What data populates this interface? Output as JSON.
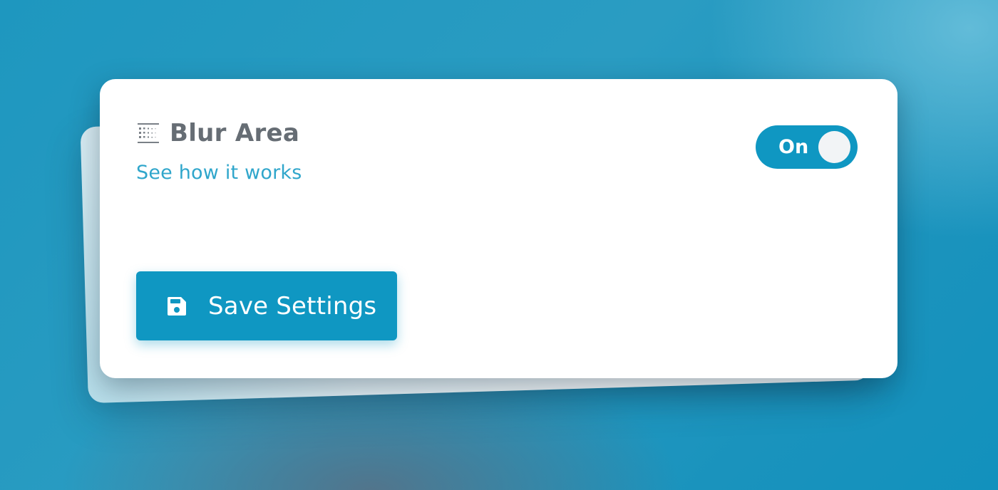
{
  "panel": {
    "icon": "blur-grid-icon",
    "title": "Blur Area",
    "help_link": "See how it works",
    "toggle": {
      "label": "On",
      "state": true
    },
    "save_button": {
      "icon": "floppy-disk-icon",
      "label": "Save Settings"
    }
  },
  "colors": {
    "accent": "#0f97c2",
    "link": "#2fa6cb",
    "title_text": "#666d74",
    "background": "#1e97bf"
  }
}
